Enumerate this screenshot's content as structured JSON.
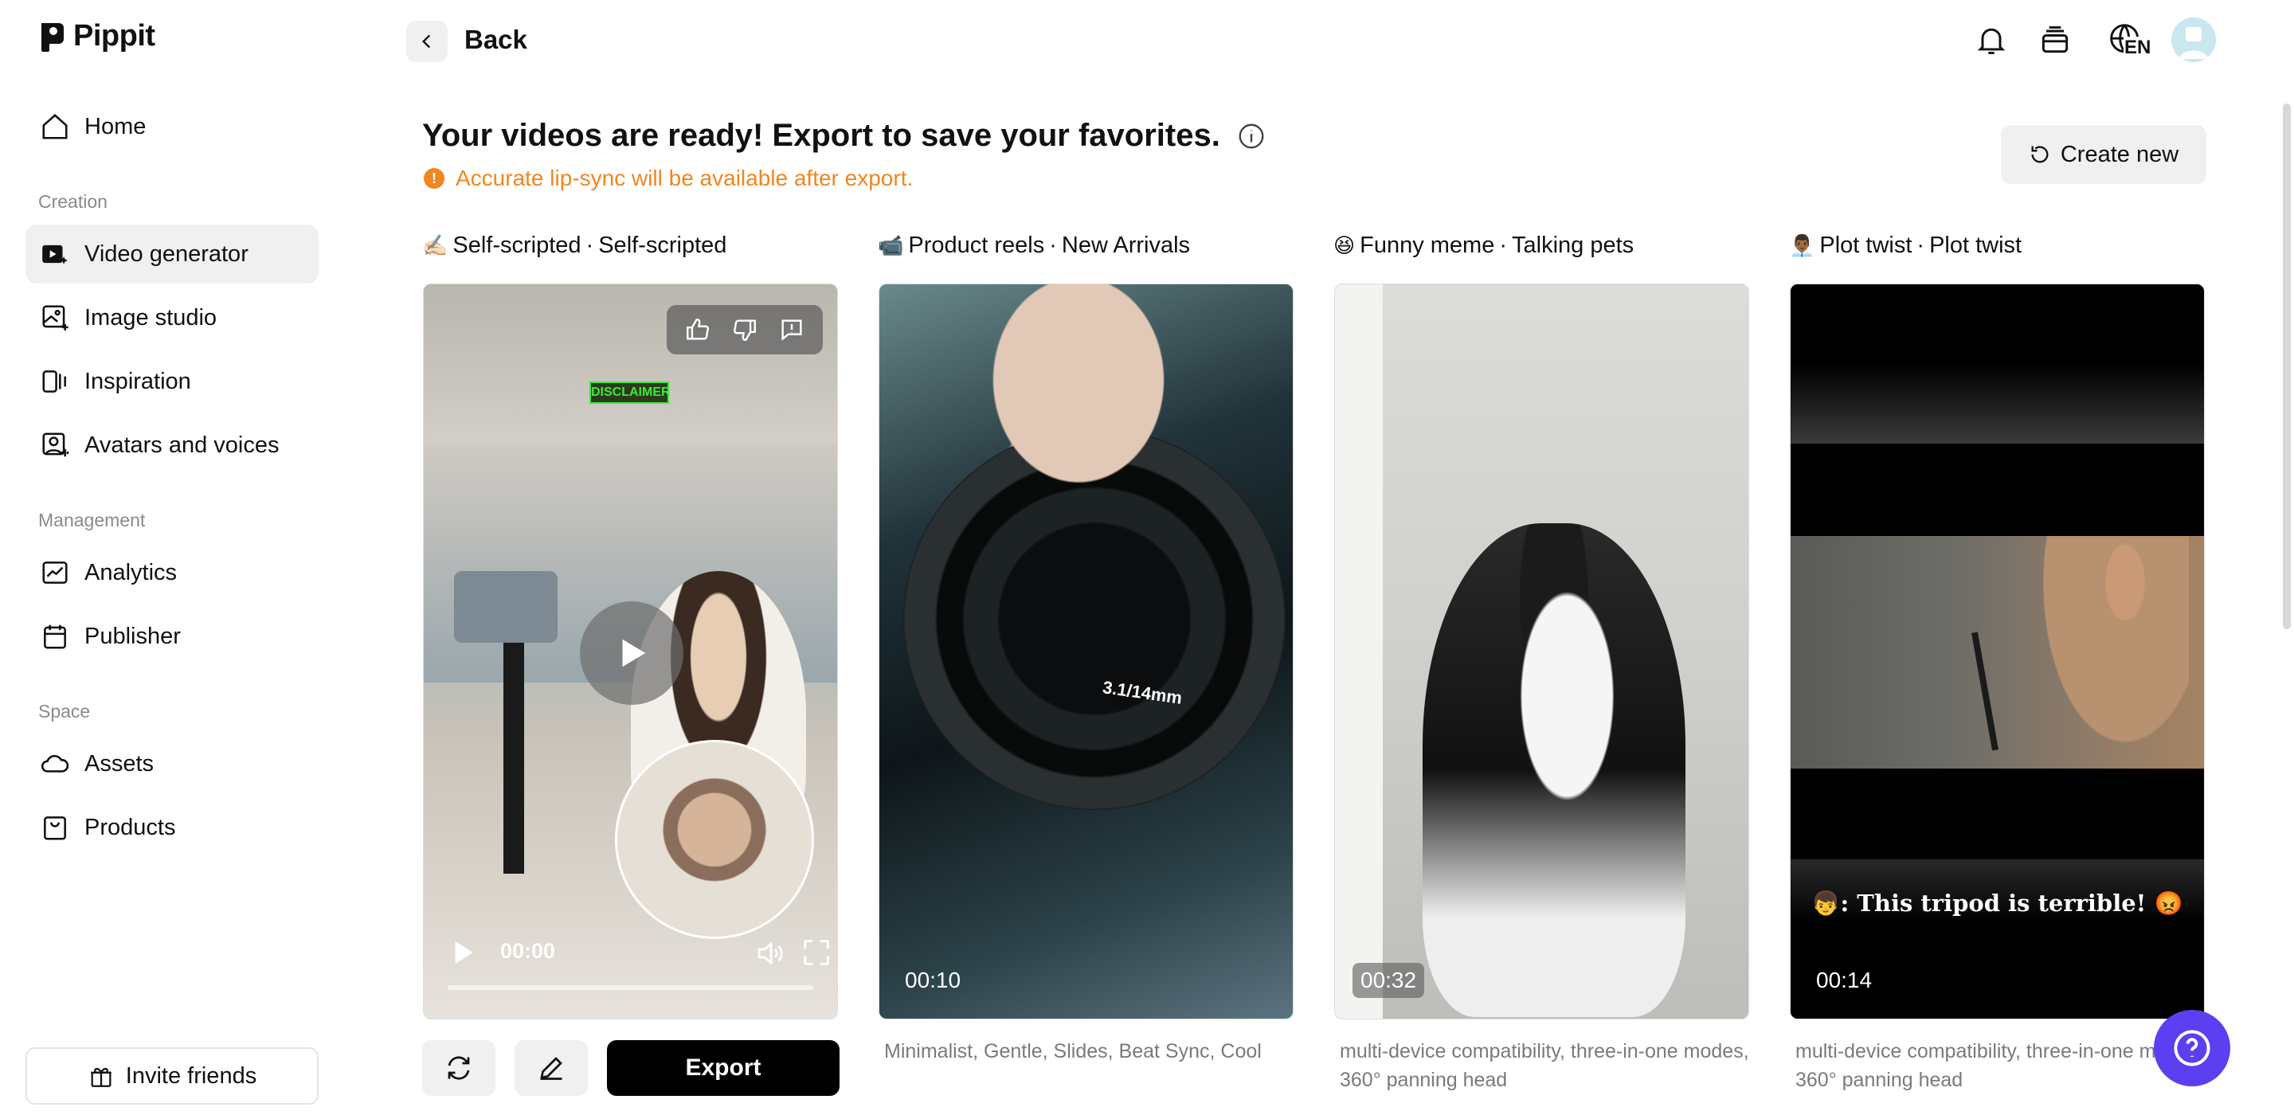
{
  "app": {
    "name": "Pippit"
  },
  "sidebar": {
    "items_top": [
      {
        "label": "Home",
        "icon": "home-icon"
      }
    ],
    "sections": [
      {
        "title": "Creation",
        "items": [
          {
            "label": "Video generator",
            "icon": "video-generator-icon",
            "active": true
          },
          {
            "label": "Image studio",
            "icon": "image-studio-icon"
          },
          {
            "label": "Inspiration",
            "icon": "inspiration-icon"
          },
          {
            "label": "Avatars and voices",
            "icon": "avatar-icon"
          }
        ]
      },
      {
        "title": "Management",
        "items": [
          {
            "label": "Analytics",
            "icon": "analytics-icon"
          },
          {
            "label": "Publisher",
            "icon": "calendar-icon"
          }
        ]
      },
      {
        "title": "Space",
        "items": [
          {
            "label": "Assets",
            "icon": "cloud-icon"
          },
          {
            "label": "Products",
            "icon": "box-icon"
          }
        ]
      }
    ],
    "invite": "Invite friends"
  },
  "header": {
    "back": "Back",
    "language": "EN"
  },
  "main": {
    "title": "Your videos are ready! Export to save your favorites.",
    "warning": "Accurate lip-sync will be available after export.",
    "create_new": "Create new",
    "export": "Export"
  },
  "cards": [
    {
      "emoji": "✍🏻",
      "title": "Self-scripted",
      "subtitle": "Self-scripted",
      "duration": "00:00",
      "description": "",
      "overlay_text": "DISCLAIMER"
    },
    {
      "emoji": "📹",
      "title": "Product reels",
      "subtitle": "New Arrivals",
      "duration": "00:10",
      "description": "Minimalist, Gentle, Slides, Beat Sync, Cool",
      "overlay_text": "3.1/14mm"
    },
    {
      "emoji": "😆",
      "title": "Funny meme",
      "subtitle": "Talking pets",
      "duration": "00:32",
      "description": "multi-device compatibility, three-in-one modes, 360° panning head"
    },
    {
      "emoji": "👨🏾‍💼",
      "title": "Plot twist",
      "subtitle": "Plot twist",
      "duration": "00:14",
      "description": "multi-device compatibility, three-in-one modes, 360° panning head",
      "caption": "👦: This tripod is terrible! 😡"
    }
  ],
  "colors": {
    "accent": "#5b3ff1",
    "warning": "#f0861f",
    "active_bg": "#f0f0f0"
  }
}
